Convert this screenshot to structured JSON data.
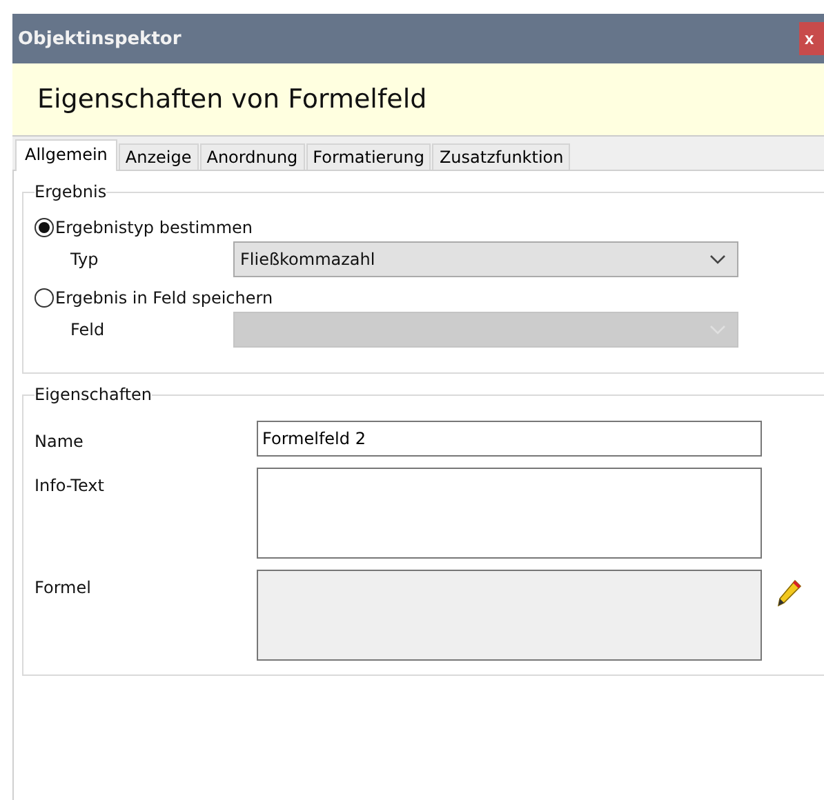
{
  "window": {
    "title": "Objektinspektor",
    "close": "x"
  },
  "header": {
    "title": "Eigenschaften von Formelfeld"
  },
  "tabs": [
    {
      "label": "Allgemein",
      "selected": true
    },
    {
      "label": "Anzeige",
      "selected": false
    },
    {
      "label": "Anordnung",
      "selected": false
    },
    {
      "label": "Formatierung",
      "selected": false
    },
    {
      "label": "Zusatzfunktion",
      "selected": false
    }
  ],
  "result_group": {
    "legend": "Ergebnis",
    "options": [
      {
        "label": "Ergebnistyp bestimmen",
        "selected": true,
        "field": {
          "label": "Typ",
          "value": "Fließkommazahl",
          "disabled": false
        }
      },
      {
        "label": "Ergebnis in Feld speichern",
        "selected": false,
        "field": {
          "label": "Feld",
          "disabled": true
        }
      }
    ]
  },
  "properties_group": {
    "legend": "Eigenschaften",
    "fields": [
      {
        "label": "Name",
        "kind": "text",
        "value": "Formelfeld 2"
      },
      {
        "label": "Info-Text",
        "kind": "textarea"
      },
      {
        "label": "Formel",
        "kind": "formula"
      }
    ]
  }
}
